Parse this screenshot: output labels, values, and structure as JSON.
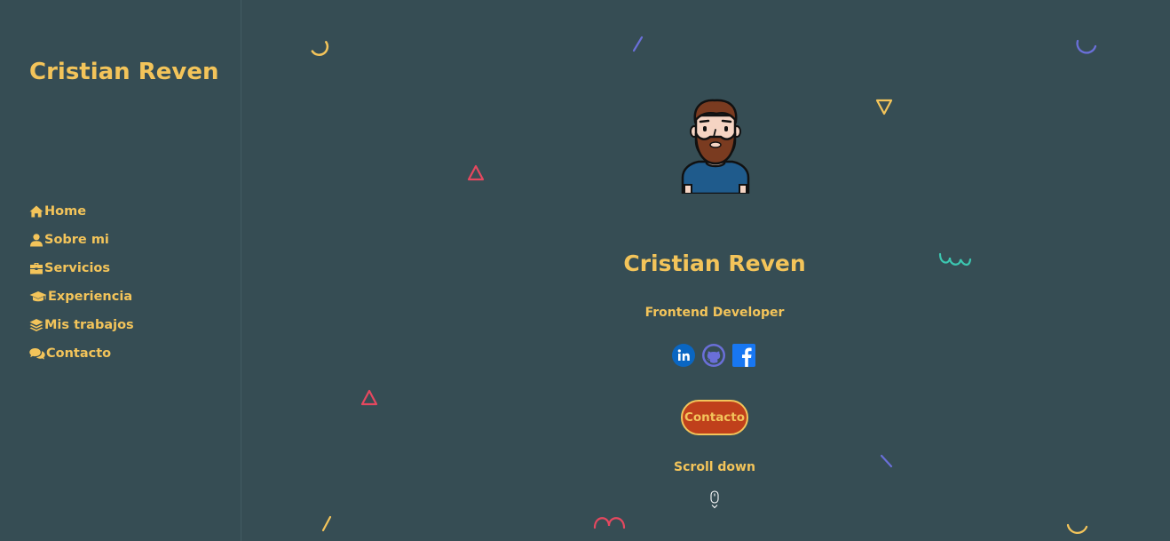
{
  "sidebar": {
    "brand": "Cristian Reven",
    "items": [
      {
        "label": "Home",
        "icon": "home-icon"
      },
      {
        "label": "Sobre mi",
        "icon": "user-icon"
      },
      {
        "label": "Servicios",
        "icon": "briefcase-icon"
      },
      {
        "label": "Experiencia",
        "icon": "graduation-cap-icon"
      },
      {
        "label": "Mis trabajos",
        "icon": "layers-icon"
      },
      {
        "label": "Contacto",
        "icon": "comments-icon"
      }
    ]
  },
  "hero": {
    "name": "Cristian Reven",
    "role": "Frontend Developer",
    "socials": [
      "linkedin-icon",
      "github-icon",
      "facebook-icon"
    ],
    "contact_label": "Contacto",
    "scroll_label": "Scroll down"
  },
  "colors": {
    "background": "#364d54",
    "accent": "#f3c45a",
    "button": "#c0401b",
    "shape_red": "#e5485f",
    "shape_blue": "#6a6fd8",
    "shape_teal": "#3cc6b0"
  }
}
